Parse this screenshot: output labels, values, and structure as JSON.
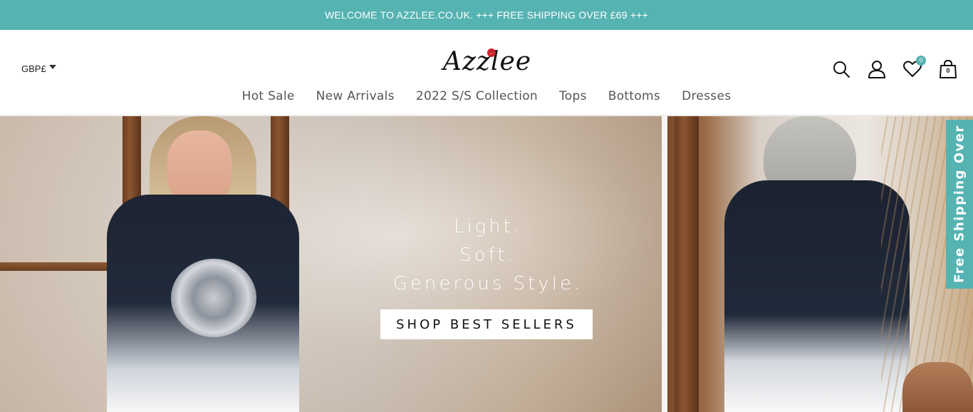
{
  "announcement": {
    "text": "WELCOME TO AZZLEE.CO.UK. +++ FREE SHIPPING OVER £69 +++"
  },
  "header": {
    "currency": "GBP£",
    "logo": "Azzlee",
    "wishlist_count": "0",
    "bag_count": "0"
  },
  "nav": {
    "items": [
      {
        "label": "Hot Sale"
      },
      {
        "label": "New Arrivals"
      },
      {
        "label": "2022 S/S Collection"
      },
      {
        "label": "Tops"
      },
      {
        "label": "Bottoms"
      },
      {
        "label": "Dresses"
      }
    ]
  },
  "hero": {
    "lines": [
      "Light.",
      "Soft.",
      "Generous Style."
    ],
    "cta": "SHOP BEST SELLERS"
  },
  "side_tab": {
    "text": "Free Shipping Over"
  },
  "colors": {
    "accent": "#55b3b2",
    "text": "#222222",
    "nav_text": "#555555"
  },
  "icons": [
    "search-icon",
    "account-icon",
    "heart-icon",
    "bag-icon",
    "caret-down-icon",
    "rose-icon"
  ]
}
